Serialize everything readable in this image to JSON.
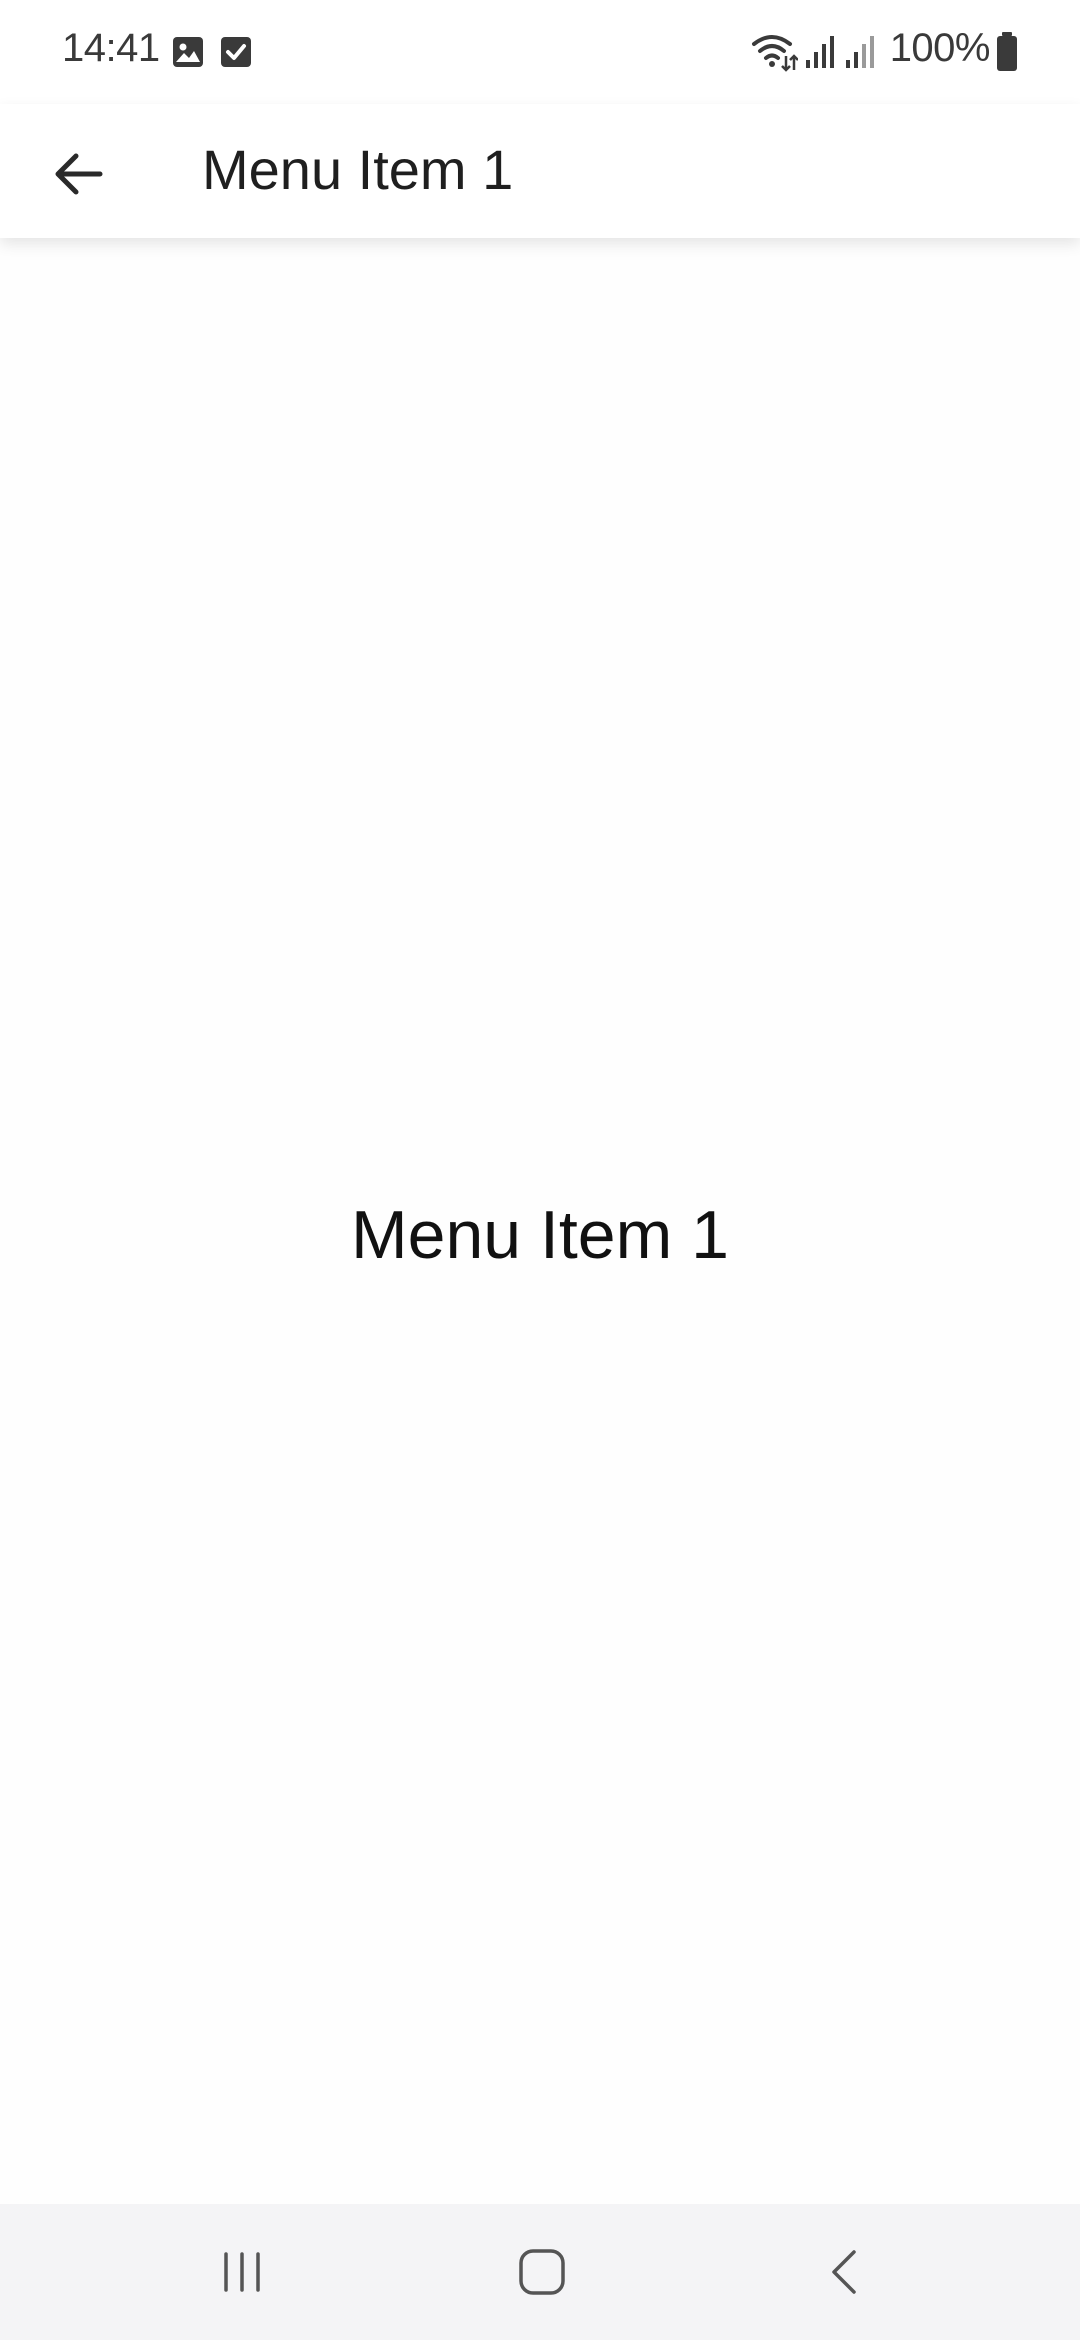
{
  "status_bar": {
    "time": "14:41",
    "battery_percent": "100%",
    "icons": [
      "gallery-icon",
      "checkbox-icon",
      "wifi-icon",
      "signal-icon",
      "signal-icon-2",
      "battery-icon"
    ]
  },
  "app_bar": {
    "title": "Menu Item 1",
    "back_icon": "arrow-back-icon"
  },
  "content": {
    "text": "Menu Item 1"
  },
  "nav_bar": {
    "icons": [
      "recent-apps-icon",
      "home-icon",
      "nav-back-icon"
    ]
  },
  "colors": {
    "background": "#fefefe",
    "app_bar": "#ffffff",
    "nav_bar": "#f4f4f6",
    "text": "#1f1f1f"
  }
}
